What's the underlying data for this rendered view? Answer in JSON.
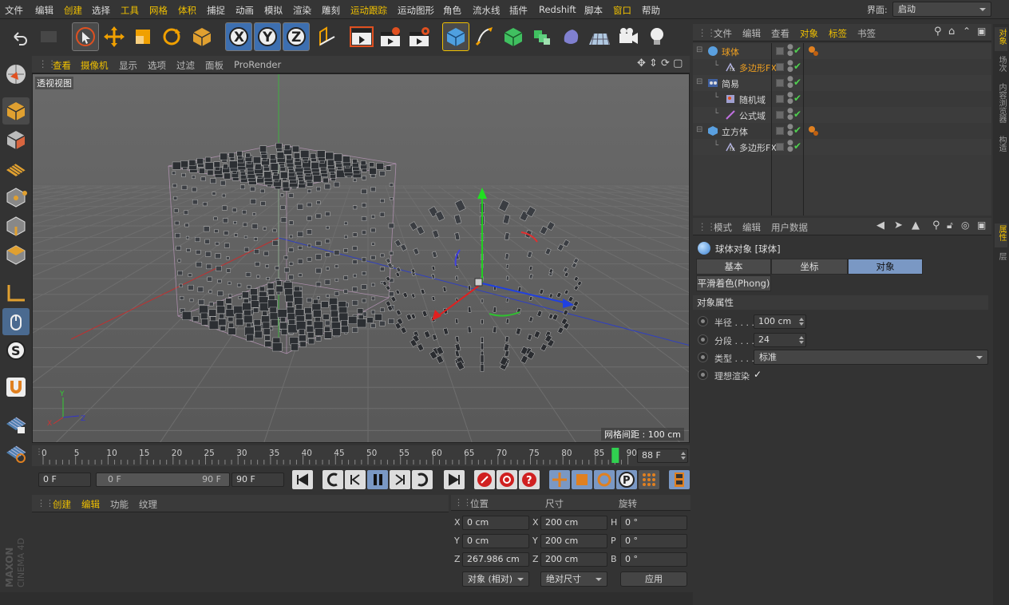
{
  "menubar": {
    "items": [
      "文件",
      "编辑",
      "创建",
      "选择",
      "工具",
      "网格",
      "体积",
      "捕捉",
      "动画",
      "模拟",
      "渲染",
      "雕刻",
      "运动跟踪",
      "运动图形",
      "角色",
      "流水线",
      "插件",
      "Redshift",
      "脚本",
      "窗口",
      "帮助"
    ],
    "layout_label": "界面:",
    "layout_value": "启动"
  },
  "toolbar": {
    "icons": [
      "undo-icon",
      "redo-icon",
      "live-select-icon",
      "move-icon",
      "scale-icon",
      "rotate-icon",
      "recent-tools-icon",
      "x-axis-icon",
      "y-axis-icon",
      "z-axis-icon",
      "coordinate-system-icon",
      "render-view-icon",
      "render-picture-viewer-icon",
      "render-settings-icon",
      "cube-primitive-icon",
      "pen-spline-icon",
      "subdivision-icon",
      "array-icon",
      "deformer-icon",
      "floor-icon",
      "camera-icon",
      "light-icon"
    ],
    "axis_labels": [
      "X",
      "Y",
      "Z"
    ]
  },
  "left_toolbar": {
    "icons": [
      "make-editable-icon",
      "model-mode-icon",
      "texture-mode-icon",
      "workplane-mode-icon",
      "points-mode-icon",
      "edges-mode-icon",
      "polygons-mode-icon",
      "axis-mode-icon",
      "tweak-mode-icon",
      "solo-icon",
      "snap-magnet-icon",
      "lock-workplane-icon",
      "grid-snap-icon"
    ]
  },
  "viewport": {
    "menu": [
      "查看",
      "摄像机",
      "显示",
      "选项",
      "过滤",
      "面板",
      "ProRender"
    ],
    "view_name": "透视视图",
    "grid_info": "网格间距 : 100 cm",
    "axis_labels": {
      "y": "Y",
      "x": "X",
      "z": "Z"
    }
  },
  "timeline": {
    "ticks": [
      "0",
      "5",
      "10",
      "15",
      "20",
      "25",
      "30",
      "35",
      "40",
      "45",
      "50",
      "55",
      "60",
      "65",
      "70",
      "75",
      "80",
      "85",
      "90"
    ],
    "current_frame_value": 88,
    "current_frame": "88 F"
  },
  "transport": {
    "start": "0 F",
    "range_start": "0 F",
    "range_end": "90 F",
    "end": "90 F"
  },
  "material_panel": {
    "menu": [
      "创建",
      "编辑",
      "功能",
      "纹理"
    ]
  },
  "coord_panel": {
    "headers": [
      "位置",
      "尺寸",
      "旋转"
    ],
    "rows": [
      {
        "axis": "X",
        "pos": "0 cm",
        "size_axis": "X",
        "size": "200 cm",
        "rot_axis": "H",
        "rot": "0 °"
      },
      {
        "axis": "Y",
        "pos": "0 cm",
        "size_axis": "Y",
        "size": "200 cm",
        "rot_axis": "P",
        "rot": "0 °"
      },
      {
        "axis": "Z",
        "pos": "267.986 cm",
        "size_axis": "Z",
        "size": "200 cm",
        "rot_axis": "B",
        "rot": "0 °"
      }
    ],
    "mode": "对象 (相对)",
    "size_mode": "绝对尺寸",
    "apply": "应用"
  },
  "object_manager": {
    "menu": [
      "文件",
      "编辑",
      "查看",
      "对象",
      "标签",
      "书签"
    ],
    "objects": [
      {
        "name": "球体",
        "indent": 0,
        "icon": "sphere-icon",
        "active": true,
        "tag": true
      },
      {
        "name": "多边形FX",
        "indent": 1,
        "icon": "polyfx-icon",
        "active": true,
        "tag": false
      },
      {
        "name": "简易",
        "indent": 0,
        "icon": "plain-effector-icon",
        "active": false,
        "tag": false
      },
      {
        "name": "随机域",
        "indent": 1,
        "icon": "random-field-icon",
        "active": false,
        "tag": false
      },
      {
        "name": "公式域",
        "indent": 1,
        "icon": "formula-field-icon",
        "active": false,
        "tag": false
      },
      {
        "name": "立方体",
        "indent": 0,
        "icon": "cube-icon",
        "active": false,
        "tag": true
      },
      {
        "name": "多边形FX",
        "indent": 1,
        "icon": "polyfx-icon",
        "active": false,
        "tag": false
      }
    ]
  },
  "attribute_manager": {
    "menu": [
      "模式",
      "编辑",
      "用户数据"
    ],
    "title": "球体对象 [球体]",
    "tabs": [
      "基本",
      "坐标",
      "对象"
    ],
    "active_tab": "对象",
    "phong_tab": "平滑着色(Phong)",
    "section": "对象属性",
    "props": [
      {
        "label": "半径 . . . .",
        "value": "100 cm"
      },
      {
        "label": "分段 . . . .",
        "value": "24"
      },
      {
        "label": "类型 . . . .",
        "value": "标准"
      },
      {
        "label": "理想渲染",
        "value": "✓"
      }
    ]
  },
  "side_tabs": [
    "对象",
    "场次",
    "内容浏览器",
    "构造",
    "属性",
    "层"
  ],
  "brand": "MAXON CINEMA 4D",
  "colors": {
    "accent": "#f0c000",
    "active_tab": "#7a98c4",
    "bg": "#333333",
    "viewport": "#5d5d5d"
  }
}
